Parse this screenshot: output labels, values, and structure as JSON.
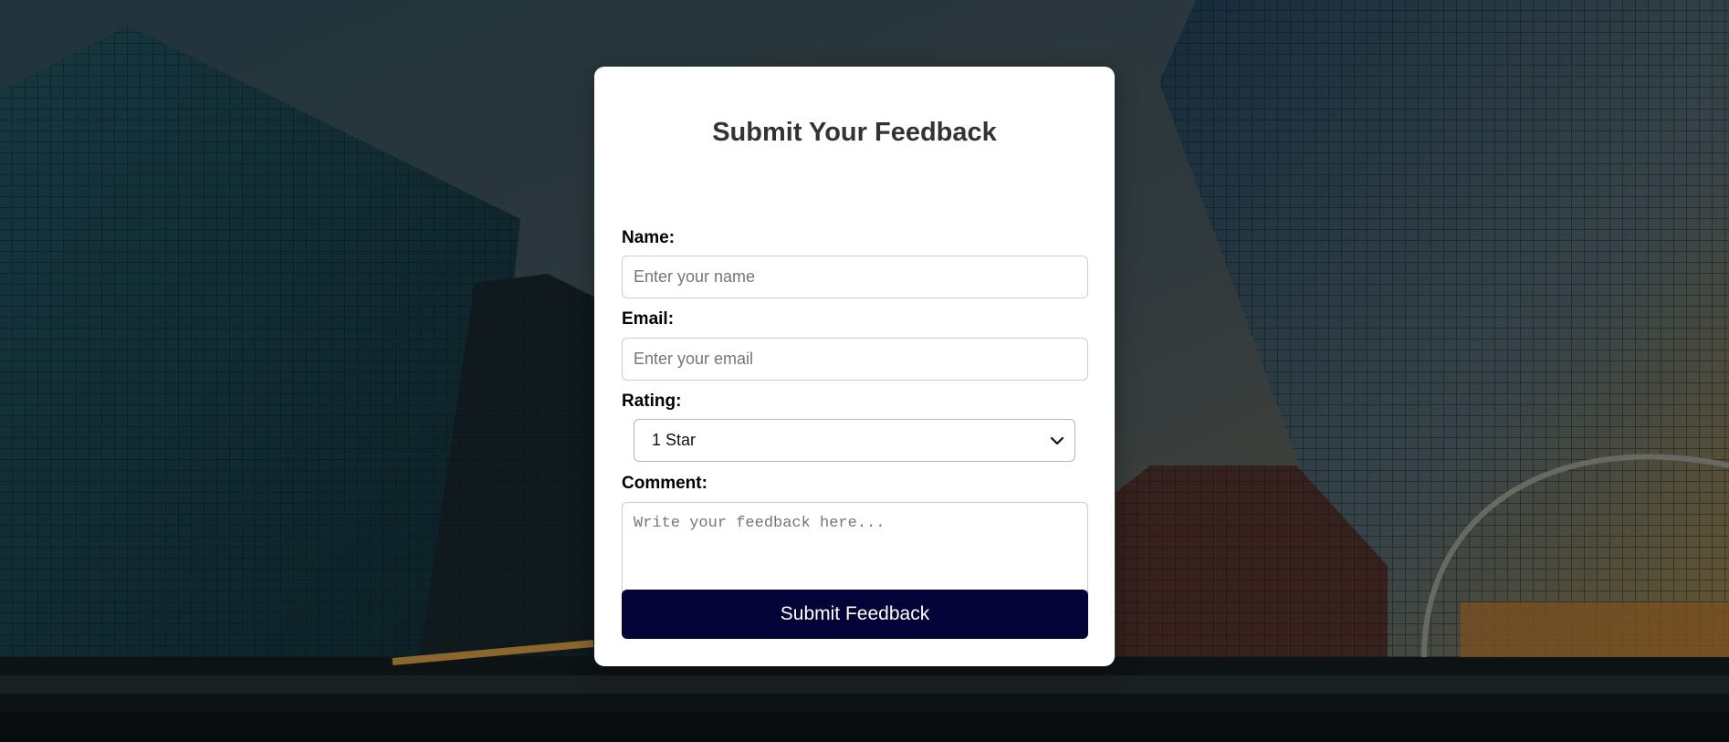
{
  "form": {
    "title": "Submit Your Feedback",
    "name": {
      "label": "Name:",
      "placeholder": "Enter your name",
      "value": ""
    },
    "email": {
      "label": "Email:",
      "placeholder": "Enter your email",
      "value": ""
    },
    "rating": {
      "label": "Rating:",
      "selected": "1 Star"
    },
    "comment": {
      "label": "Comment:",
      "placeholder": "Write your feedback here...",
      "value": ""
    },
    "submit_label": "Submit Feedback"
  },
  "colors": {
    "button": "#030338",
    "card": "#ffffff",
    "title": "#333333"
  },
  "icons": {
    "select_arrow": "chevron-down-icon"
  }
}
